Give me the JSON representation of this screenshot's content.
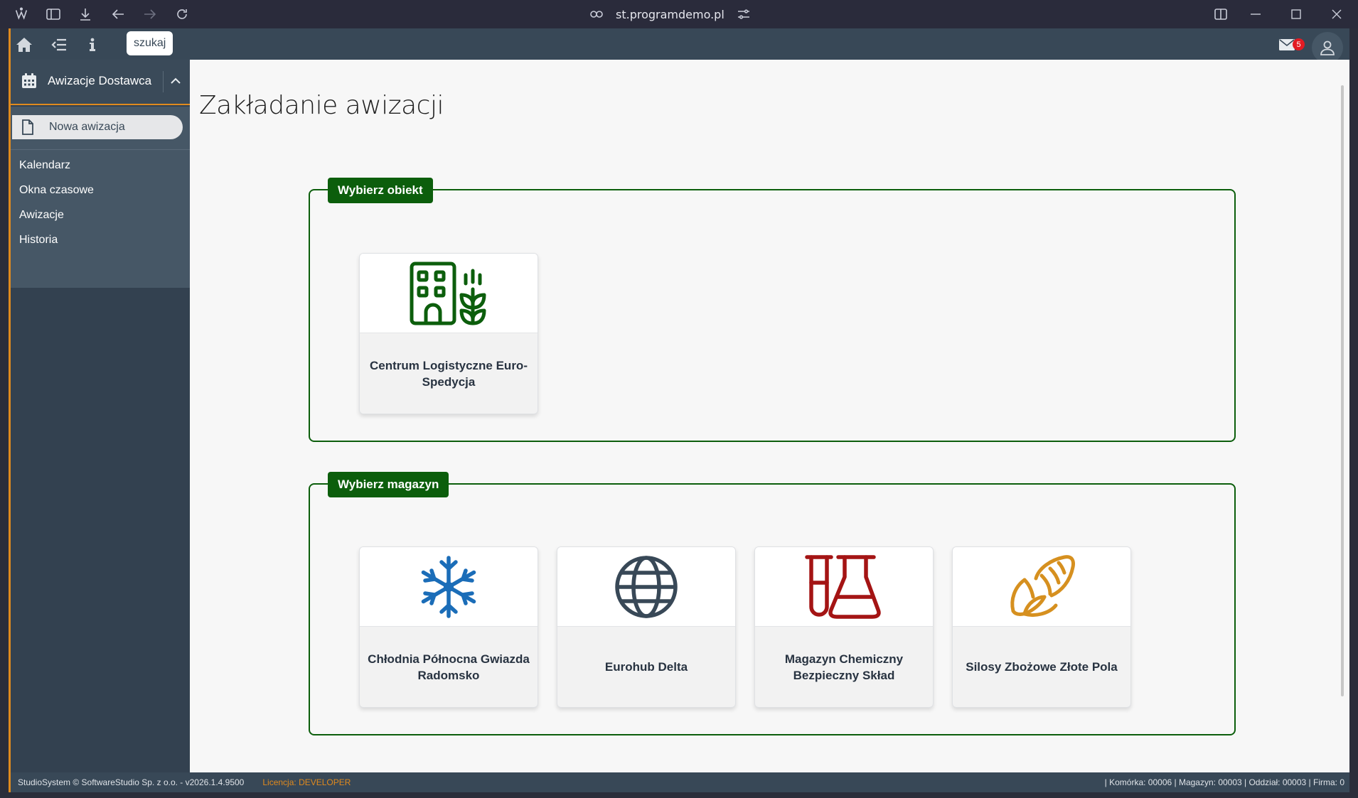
{
  "browser": {
    "url": "st.programdemo.pl"
  },
  "topbar": {
    "search_label": "szukaj",
    "mail_count": "5"
  },
  "sidebar": {
    "module_title": "Awizacje Dostawca",
    "new_item_label": "Nowa awizacja",
    "items": [
      {
        "label": "Kalendarz"
      },
      {
        "label": "Okna czasowe"
      },
      {
        "label": "Awizacje"
      },
      {
        "label": "Historia"
      }
    ]
  },
  "main": {
    "page_title": "Zakładanie awizacji",
    "object_section": {
      "legend": "Wybierz obiekt",
      "cards": [
        {
          "name": "Centrum Logistyczne Euro-Spedycja",
          "icon": "building-wheat-icon",
          "color": "#0c5e0c"
        }
      ]
    },
    "warehouse_section": {
      "legend": "Wybierz magazyn",
      "cards": [
        {
          "name": "Chłodnia Północna Gwiazda Radomsko",
          "icon": "snowflake-icon",
          "color": "#1b6db8"
        },
        {
          "name": "Eurohub Delta",
          "icon": "globe-icon",
          "color": "#384857"
        },
        {
          "name": "Magazyn Chemiczny Bezpieczny Skład",
          "icon": "flask-vial-icon",
          "color": "#a41414"
        },
        {
          "name": "Silosy Zbożowe Złote Pola",
          "icon": "wheat-ear-icon",
          "color": "#d6901f"
        }
      ]
    }
  },
  "footer": {
    "copyright": "StudioSystem © SoftwareStudio Sp. z o.o. - v2026.1.4.9500",
    "license_label": "Licencja:",
    "license_value": "DEVELOPER",
    "status": "| Komórka: 00006 | Magazyn: 00003 | Oddział: 00003 | Firma: 0"
  },
  "colors": {
    "accent": "#e08a1e",
    "brand_green": "#0c5e0c",
    "sidebar": "#334150",
    "topbar": "#384857"
  }
}
